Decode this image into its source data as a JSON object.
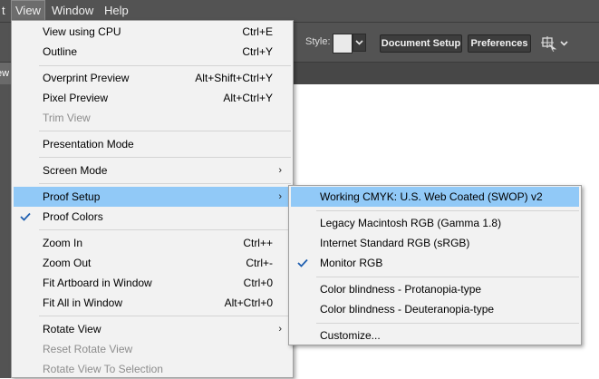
{
  "menubar": {
    "items": [
      "t",
      "View",
      "Window",
      "Help"
    ]
  },
  "controlbar": {
    "style_label": "Style:",
    "document_setup_label": "Document Setup",
    "preferences_label": "Preferences"
  },
  "doc_tab_fragment": "ew",
  "view_menu": {
    "items": [
      {
        "label": "View using CPU",
        "shortcut": "Ctrl+E"
      },
      {
        "label": "Outline",
        "shortcut": "Ctrl+Y"
      },
      {
        "label": "Overprint Preview",
        "shortcut": "Alt+Shift+Ctrl+Y"
      },
      {
        "label": "Pixel Preview",
        "shortcut": "Alt+Ctrl+Y"
      },
      {
        "label": "Trim View",
        "shortcut": "",
        "disabled": true
      },
      {
        "label": "Presentation Mode",
        "shortcut": ""
      },
      {
        "label": "Screen Mode",
        "shortcut": "",
        "submenu": true
      },
      {
        "label": "Proof Setup",
        "shortcut": "",
        "submenu": true,
        "highlighted": true
      },
      {
        "label": "Proof Colors",
        "shortcut": "",
        "checked": true
      },
      {
        "label": "Zoom In",
        "shortcut": "Ctrl++"
      },
      {
        "label": "Zoom Out",
        "shortcut": "Ctrl+-"
      },
      {
        "label": "Fit Artboard in Window",
        "shortcut": "Ctrl+0"
      },
      {
        "label": "Fit All in Window",
        "shortcut": "Alt+Ctrl+0"
      },
      {
        "label": "Rotate View",
        "shortcut": "",
        "submenu": true
      },
      {
        "label": "Reset Rotate View",
        "shortcut": "",
        "disabled": true
      },
      {
        "label": "Rotate View To Selection",
        "shortcut": "",
        "disabled": true
      }
    ]
  },
  "proof_setup_menu": {
    "items": [
      {
        "label": "Working CMYK: U.S. Web Coated (SWOP) v2",
        "highlighted": true
      },
      {
        "label": "Legacy Macintosh RGB (Gamma 1.8)"
      },
      {
        "label": "Internet Standard RGB (sRGB)"
      },
      {
        "label": "Monitor RGB",
        "checked": true
      },
      {
        "label": "Color blindness - Protanopia-type"
      },
      {
        "label": "Color blindness - Deuteranopia-type"
      },
      {
        "label": "Customize..."
      }
    ]
  },
  "colors": {
    "menu_highlight": "#91c9f7",
    "chrome": "#535353",
    "check": "#1f5fb0"
  },
  "icons": {
    "submenu_arrow": "chevron-right-icon",
    "check": "checkmark-icon",
    "arrange": "arrange-documents-icon",
    "dropdown": "chevron-down-icon"
  }
}
